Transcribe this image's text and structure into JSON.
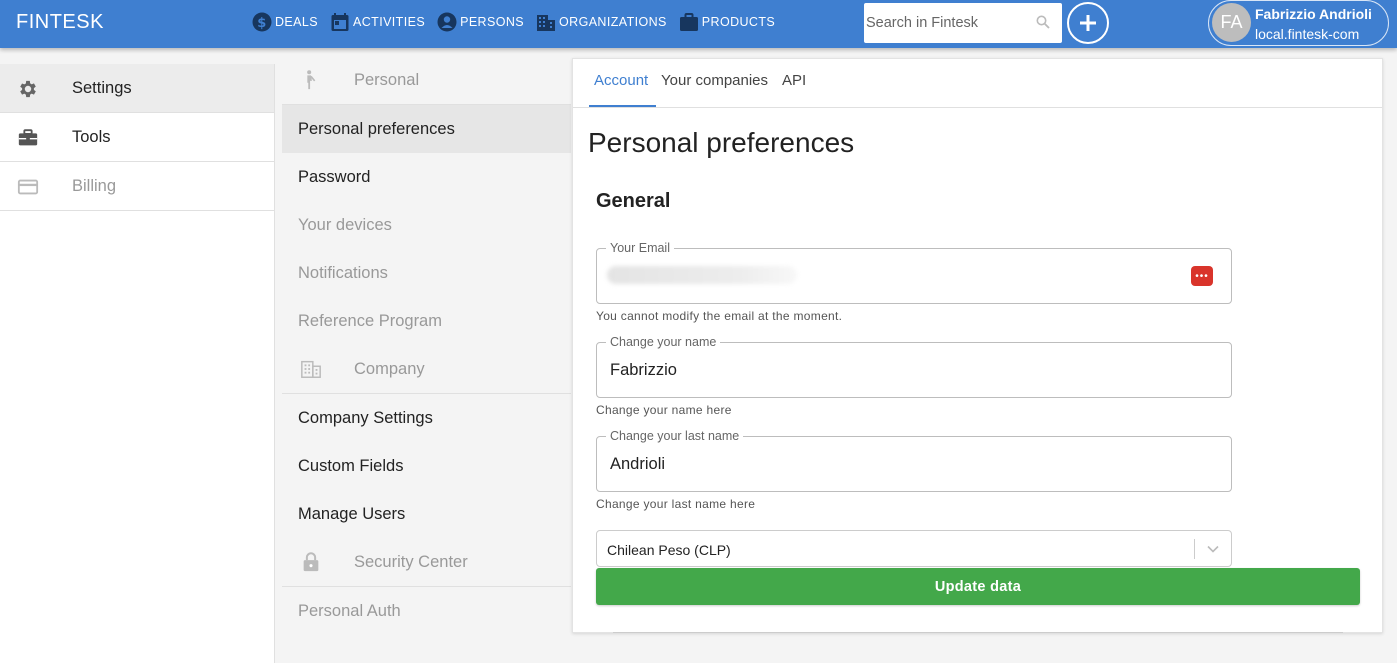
{
  "app": {
    "brand": "FINTESK"
  },
  "nav": [
    {
      "label": "DEALS",
      "icon": "dollar-icon"
    },
    {
      "label": "ACTIVITIES",
      "icon": "calendar-icon"
    },
    {
      "label": "PERSONS",
      "icon": "person-icon"
    },
    {
      "label": "ORGANIZATIONS",
      "icon": "building-icon"
    },
    {
      "label": "PRODUCTS",
      "icon": "briefcase-icon"
    }
  ],
  "search": {
    "placeholder": "Search in Fintesk"
  },
  "user": {
    "initials": "FA",
    "name": "Fabrizzio Andrioli",
    "domain": "local.fintesk-com"
  },
  "sidebar": {
    "items": [
      {
        "label": "Settings",
        "icon": "gear-icon"
      },
      {
        "label": "Tools",
        "icon": "toolbox-icon"
      },
      {
        "label": "Billing",
        "icon": "credit-card-icon"
      }
    ]
  },
  "menu": {
    "personal_header": "Personal",
    "personal_items": [
      "Personal preferences",
      "Password",
      "Your devices",
      "Notifications",
      "Reference Program"
    ],
    "company_header": "Company",
    "company_items": [
      "Company Settings",
      "Custom Fields",
      "Manage Users"
    ],
    "security_header": "Security Center",
    "security_items": [
      "Personal Auth"
    ]
  },
  "tabs": [
    "Account",
    "Your companies",
    "API"
  ],
  "page": {
    "title": "Personal preferences",
    "section": "General",
    "email_label": "Your Email",
    "email_helper": "You cannot modify the email at the moment.",
    "name_label": "Change your name",
    "name_value": "Fabrizzio",
    "name_helper": "Change your name here",
    "lastname_label": "Change your last name",
    "lastname_value": "Andrioli",
    "lastname_helper": "Change your last name here",
    "currency_value": "Chilean Peso (CLP)",
    "submit_label": "Update data"
  },
  "colors": {
    "primary": "#3f7fd0",
    "success": "#43a84a",
    "danger": "#d9342b"
  }
}
